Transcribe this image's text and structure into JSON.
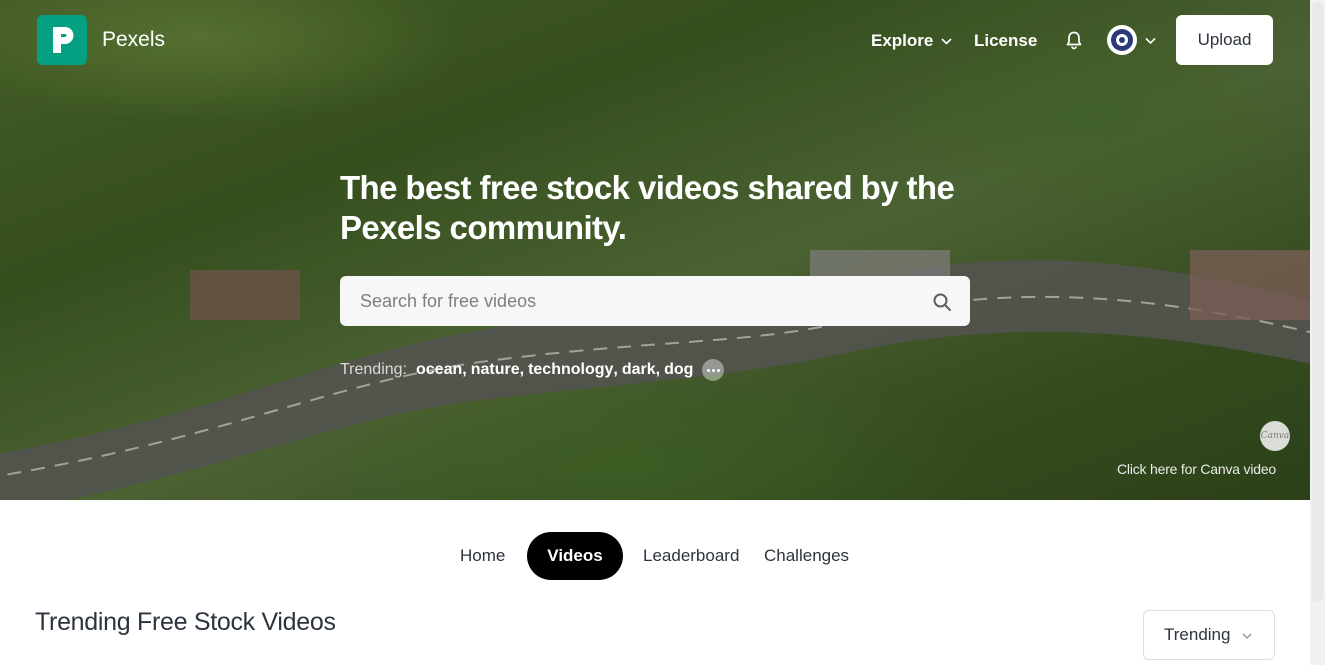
{
  "header": {
    "brand": "Pexels",
    "nav": {
      "explore": "Explore",
      "license": "License"
    },
    "upload_label": "Upload"
  },
  "hero": {
    "title": "The best free stock videos shared by the Pexels community.",
    "search": {
      "placeholder": "Search for free videos",
      "value": ""
    },
    "trending_label": "Trending:",
    "trending_tags": [
      "ocean",
      "nature",
      "technology",
      "dark",
      "dog"
    ],
    "canva_badge": "Canva",
    "canva_link": "Click here for Canva video"
  },
  "tabs": [
    {
      "label": "Home",
      "active": false
    },
    {
      "label": "Videos",
      "active": true
    },
    {
      "label": "Leaderboard",
      "active": false
    },
    {
      "label": "Challenges",
      "active": false
    }
  ],
  "section": {
    "title": "Trending Free Stock Videos",
    "sort_value": "Trending"
  },
  "colors": {
    "brand": "#05a081",
    "active_tab": "#000000",
    "text": "#2c343e"
  },
  "icons": [
    "pexels-logo-icon",
    "chevron-down-icon",
    "bell-icon",
    "avatar-icon",
    "search-icon",
    "more-icon"
  ]
}
